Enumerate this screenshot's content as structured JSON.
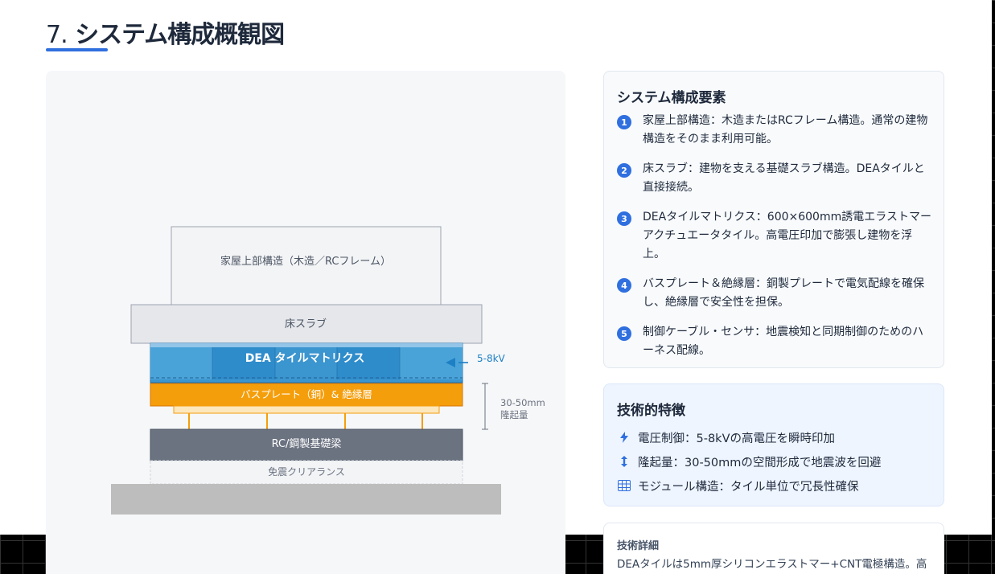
{
  "title": {
    "number": "7.",
    "text": "システム構成概観図"
  },
  "diagram": {
    "superstructure": "家屋上部構造（木造／RCフレーム）",
    "floor_slab": "床スラブ",
    "dea_tiles": "DEA タイルマトリクス",
    "voltage": "5-8kV",
    "busplate": "バスプレート（銅）& 絶縁層",
    "lift_range": "30-50mm",
    "lift_label": "隆起量",
    "beam": "RC/鋼製基礎梁",
    "clearance": "免震クリアランス",
    "colors": {
      "dea": "#3b95cf",
      "busplate": "#f59e0b",
      "beam": "#6b7280",
      "ground": "#bdbdbd",
      "accent": "#2f6fdf"
    }
  },
  "components": {
    "heading": "システム構成要素",
    "items": [
      {
        "num": "1",
        "text": "家屋上部構造：木造またはRCフレーム構造。通常の建物構造をそのまま利用可能。"
      },
      {
        "num": "2",
        "text": "床スラブ：建物を支える基礎スラブ構造。DEAタイルと直接接続。"
      },
      {
        "num": "3",
        "text": "DEAタイルマトリクス：600×600mm誘電エラストマーアクチュエータタイル。高電圧印加で膨張し建物を浮上。"
      },
      {
        "num": "4",
        "text": "バスプレート＆絶縁層：銅製プレートで電気配線を確保し、絶縁層で安全性を担保。"
      },
      {
        "num": "5",
        "text": "制御ケーブル・センサ：地震検知と同期制御のためのハーネス配線。"
      }
    ]
  },
  "features": {
    "heading": "技術的特徴",
    "items": [
      {
        "icon": "bolt-icon",
        "text": "電圧制御：5-8kVの高電圧を瞬時印加"
      },
      {
        "icon": "updown-arrow-icon",
        "text": "隆起量：30-50mmの空間形成で地震波を回避"
      },
      {
        "icon": "grid-icon",
        "text": "モジュール構造：タイル単位で冗長性確保"
      }
    ]
  },
  "details": {
    "heading": "技術詳細",
    "text": "DEAタイルは5mm厚シリコンエラストマー+CNT電極構造。高"
  }
}
